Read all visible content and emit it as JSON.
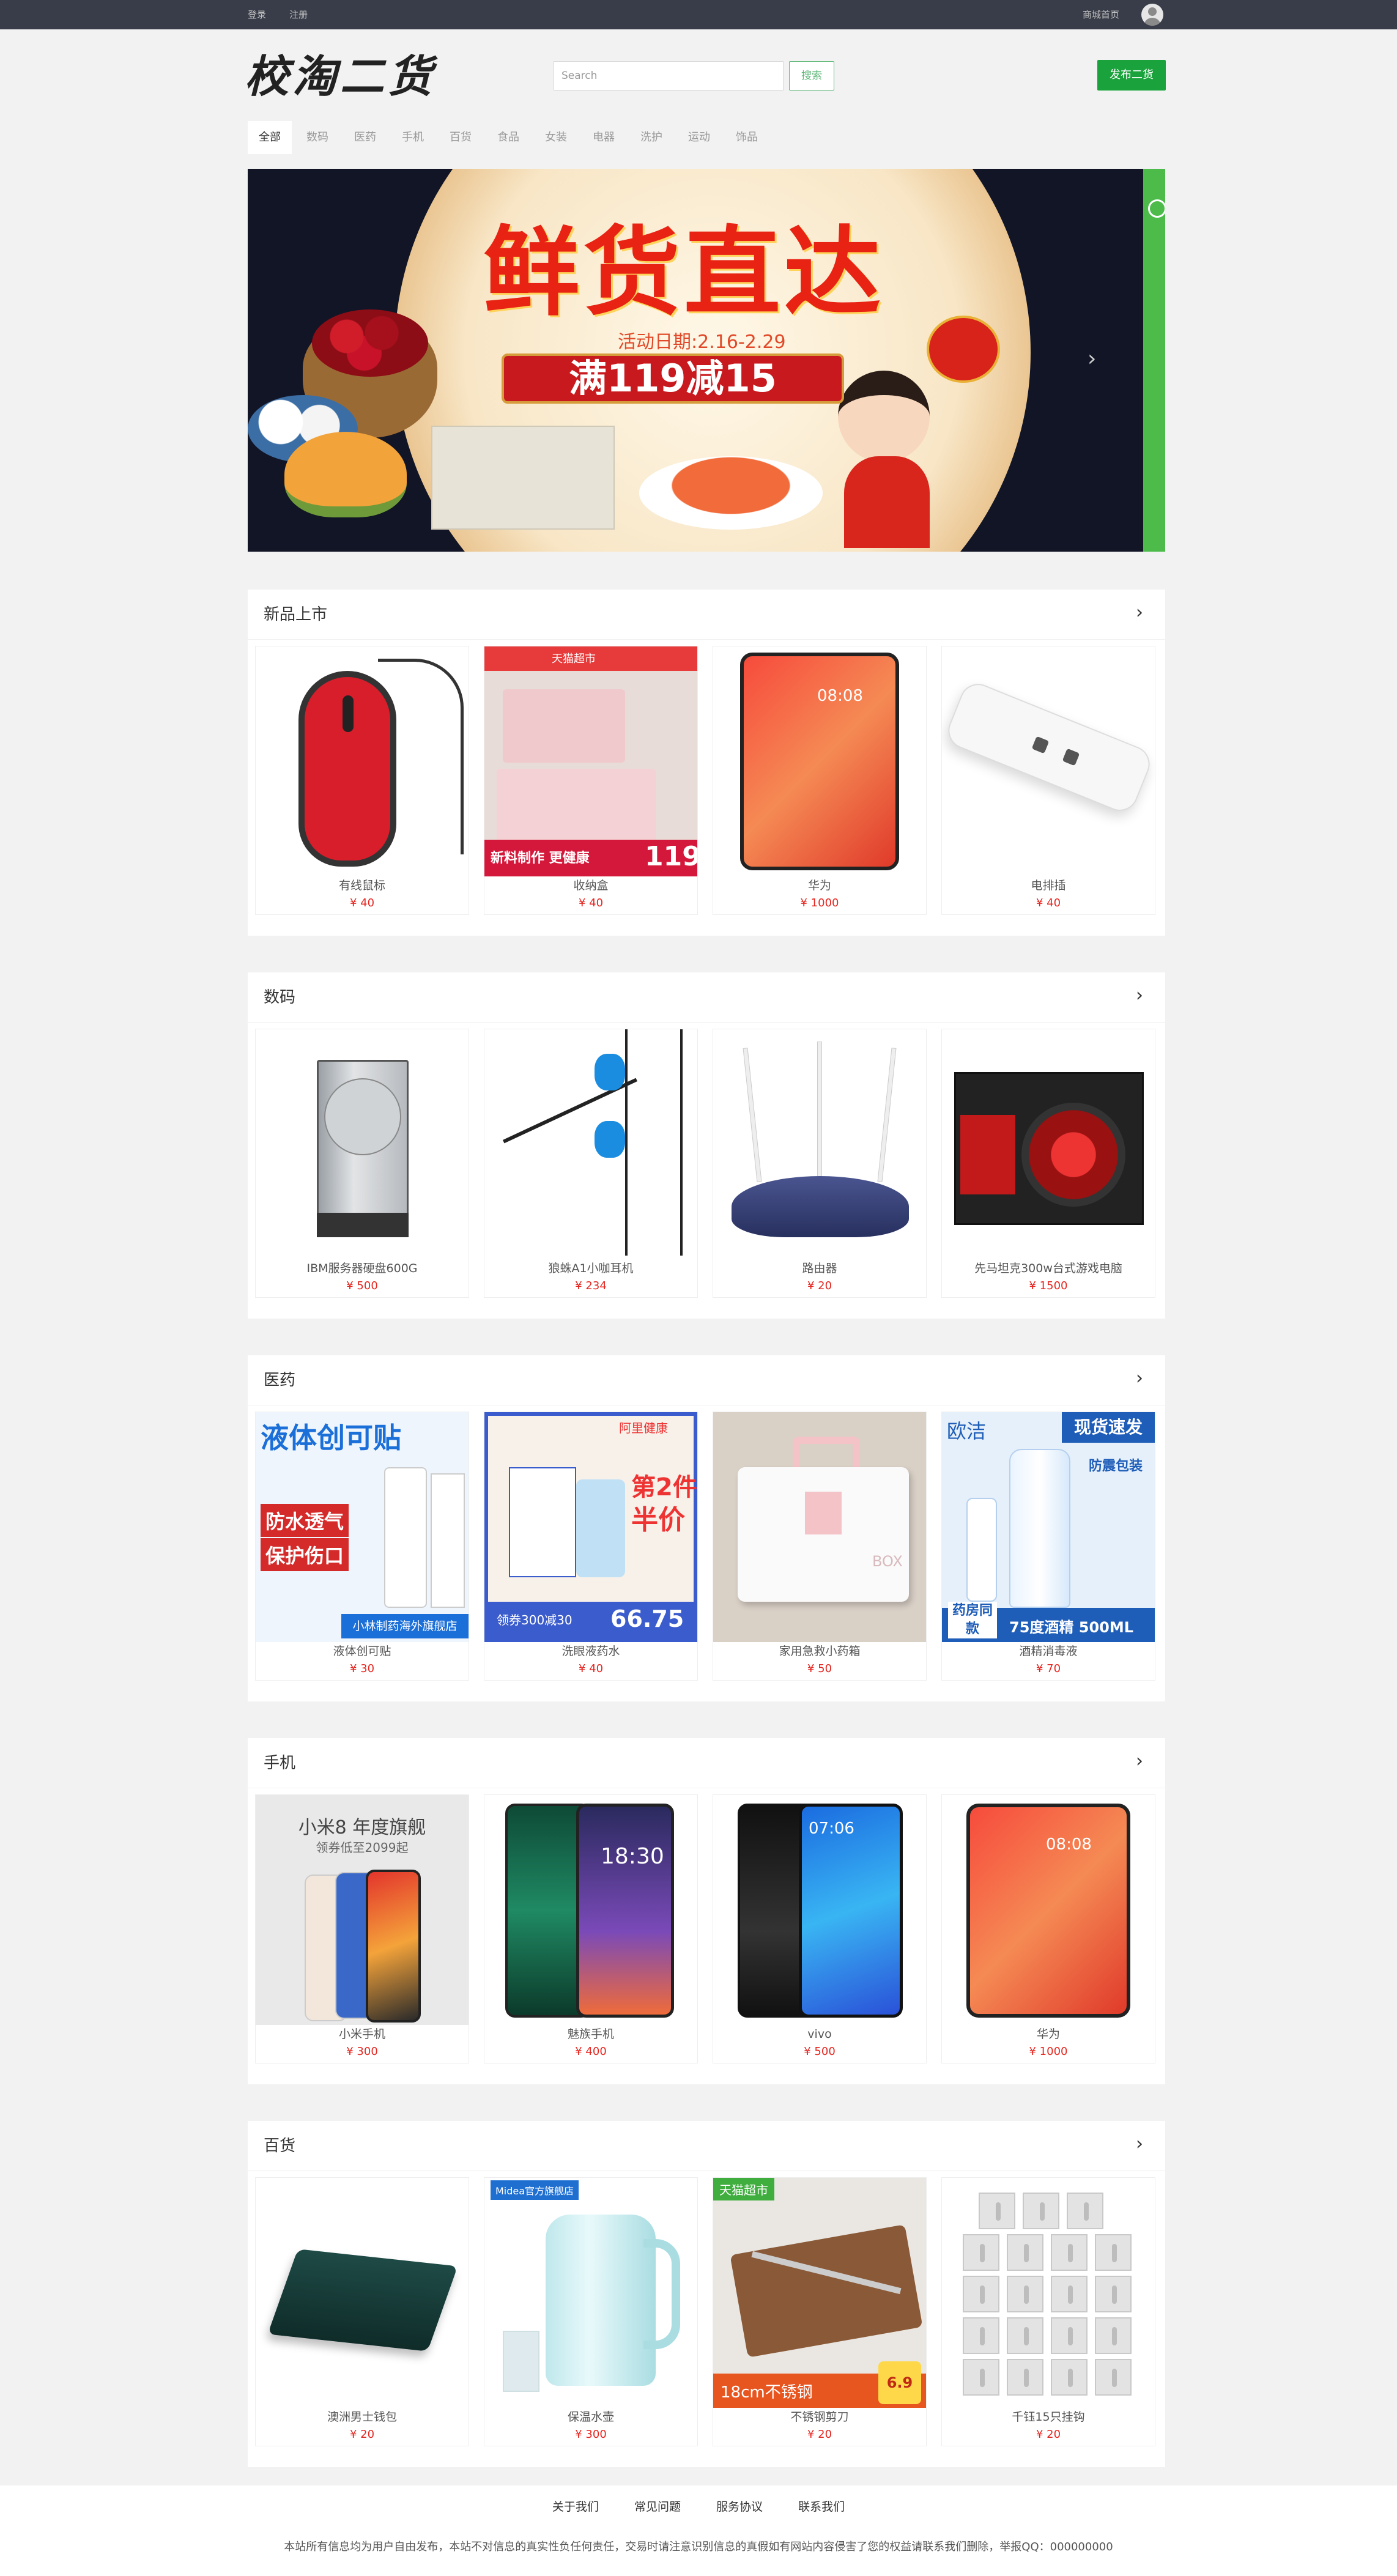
{
  "topbar": {
    "login": "登录",
    "register": "注册",
    "mall_home": "商城首页",
    "avatar_icon": "user-avatar-icon"
  },
  "header": {
    "logo": "校淘二货",
    "search_placeholder": "Search",
    "search_button": "搜索",
    "publish_button": "发布二货"
  },
  "tabs": [
    "全部",
    "数码",
    "医药",
    "手机",
    "百货",
    "食品",
    "女装",
    "电器",
    "洗护",
    "运动",
    "饰品"
  ],
  "banner": {
    "title": "鲜货直达",
    "date": "活动日期:2.16-2.29",
    "promo": "满119减15",
    "next_icon": "chevron-right-icon"
  },
  "sections": [
    {
      "title": "新品上市",
      "items": [
        {
          "name": "有线鼠标",
          "price": "¥ 40"
        },
        {
          "name": "收纳盒",
          "price": "¥ 40"
        },
        {
          "name": "华为",
          "price": "¥ 1000"
        },
        {
          "name": "电排插",
          "price": "¥ 40"
        }
      ]
    },
    {
      "title": "数码",
      "items": [
        {
          "name": "IBM服务器硬盘600G",
          "price": "¥ 500"
        },
        {
          "name": "狼蛛A1小咖耳机",
          "price": "¥ 234"
        },
        {
          "name": "路由器",
          "price": "¥ 20"
        },
        {
          "name": "先马坦克300w台式游戏电脑",
          "price": "¥ 1500"
        }
      ]
    },
    {
      "title": "医药",
      "items": [
        {
          "name": "液体创可贴",
          "price": "¥ 30"
        },
        {
          "name": "洗眼液药水",
          "price": "¥ 40"
        },
        {
          "name": "家用急救小药箱",
          "price": "¥ 50"
        },
        {
          "name": "酒精消毒液",
          "price": "¥ 70"
        }
      ]
    },
    {
      "title": "手机",
      "items": [
        {
          "name": "小米手机",
          "price": "¥ 300"
        },
        {
          "name": "魅族手机",
          "price": "¥ 400"
        },
        {
          "name": "vivo",
          "price": "¥ 500"
        },
        {
          "name": "华为",
          "price": "¥ 1000"
        }
      ]
    },
    {
      "title": "百货",
      "items": [
        {
          "name": "澳洲男士钱包",
          "price": "¥ 20"
        },
        {
          "name": "保温水壶",
          "price": "¥ 300"
        },
        {
          "name": "不锈钢剪刀",
          "price": "¥ 20"
        },
        {
          "name": "千钰15只挂钩",
          "price": "¥ 20"
        }
      ]
    }
  ],
  "image_text": {
    "storage_top": "天猫超市",
    "storage_badge": "新料制作 更健康",
    "storage_price": "119",
    "bandage_title": "液体创可贴",
    "bandage_l1": "防水透气",
    "bandage_l2": "保护伤口",
    "bandage_store": "小林制药海外旗舰店",
    "eyewash_top": "阿里健康",
    "eyewash_promo": "第2件",
    "eyewash_half": "半价",
    "eyewash_coupon": "领券300减30",
    "eyewash_price": "66.75",
    "alcohol_brand": "欧洁",
    "alcohol_badge": "现货速发",
    "alcohol_pack": "防震包装",
    "alcohol_bottom": "75度酒精 500ML",
    "alcohol_left": "药房同款",
    "xiaomi_title": "小米8 年度旗舰",
    "xiaomi_sub": "领券低至2099起",
    "kettle_brand": "Midea官方旗舰店",
    "scissor_top": "天猫超市",
    "scissor_bottom": "18cm不锈钢",
    "scissor_price": "6.9",
    "huawei_time": "08:08",
    "meizu_time": "18:30",
    "vivo_time": "07:06",
    "box_label": "BOX"
  },
  "footer": {
    "links": [
      "关于我们",
      "常见问题",
      "服务协议",
      "联系我们"
    ],
    "notice": "本站所有信息均为用户自由发布，本站不对信息的真实性负任何责任，交易时请注意识别信息的真假如有网站内容侵害了您的权益请联系我们删除，举报QQ：000000000"
  }
}
